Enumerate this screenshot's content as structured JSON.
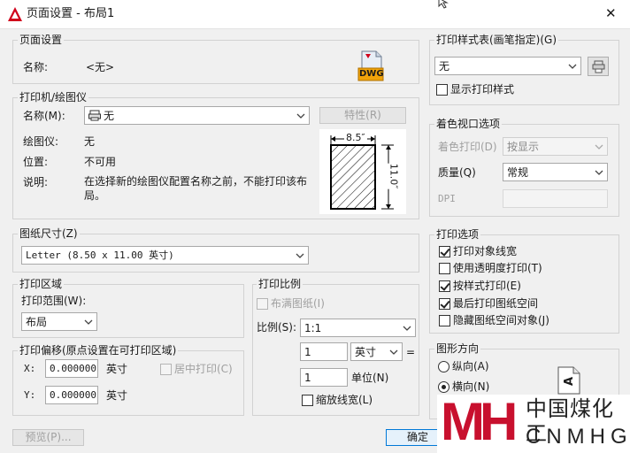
{
  "window": {
    "title": "页面设置 - 布局1",
    "close_glyph": "✕"
  },
  "page_setup": {
    "title": "页面设置",
    "name_label": "名称:",
    "name_value": "<无>",
    "dwg_label": "DWG"
  },
  "printer": {
    "title": "打印机/绘图仪",
    "name_label": "名称(M):",
    "name_value": "无",
    "properties_button": "特性(R)",
    "plotter_label": "绘图仪:",
    "plotter_value": "无",
    "location_label": "位置:",
    "location_value": "不可用",
    "description_label": "说明:",
    "description_value": "在选择新的绘图仪配置名称之前，不能打印该布局。",
    "preview_width": "8.5″",
    "preview_height": "11.0″"
  },
  "paper_size": {
    "title": "图纸尺寸(Z)",
    "value": "Letter (8.50 x 11.00 英寸)"
  },
  "plot_area": {
    "title": "打印区域",
    "range_label": "打印范围(W):",
    "range_value": "布局"
  },
  "plot_offset": {
    "title": "打印偏移(原点设置在可打印区域)",
    "x_label": "X:",
    "x_value": "0.000000",
    "x_unit": "英寸",
    "y_label": "Y:",
    "y_value": "0.000000",
    "y_unit": "英寸",
    "center_label": "居中打印(C)"
  },
  "plot_scale": {
    "title": "打印比例",
    "fit_label": "布满图纸(I)",
    "scale_label": "比例(S):",
    "scale_value": "1:1",
    "value1": "1",
    "unit1": "英寸",
    "equals": "=",
    "value2": "1",
    "unit2": "单位(N)",
    "lineweights_label": "缩放线宽(L)"
  },
  "plot_style_table": {
    "title": "打印样式表(画笔指定)(G)",
    "value": "无",
    "display_label": "显示打印样式"
  },
  "shaded_viewport": {
    "title": "着色视口选项",
    "shade_label": "着色打印(D)",
    "shade_value": "按显示",
    "quality_label": "质量(Q)",
    "quality_value": "常规",
    "dpi_label": "DPI"
  },
  "plot_options": {
    "title": "打印选项",
    "items": [
      {
        "label": "打印对象线宽",
        "checked": true
      },
      {
        "label": "使用透明度打印(T)",
        "checked": false
      },
      {
        "label": "按样式打印(E)",
        "checked": true
      },
      {
        "label": "最后打印图纸空间",
        "checked": true
      },
      {
        "label": "隐藏图纸空间对象(J)",
        "checked": false
      }
    ]
  },
  "orientation": {
    "title": "图形方向",
    "portrait": "纵向(A)",
    "landscape": "横向(N)",
    "icon_letter": "A"
  },
  "buttons": {
    "preview": "预览(P)...",
    "ok": "确定"
  },
  "watermark": {
    "mark": "MH",
    "cn": "中国煤化工",
    "en": "CNMHG"
  },
  "colors": {
    "accent_blue": "#0078d7",
    "title_icon_red": "#d0021b",
    "watermark_red": "#c8102e"
  }
}
